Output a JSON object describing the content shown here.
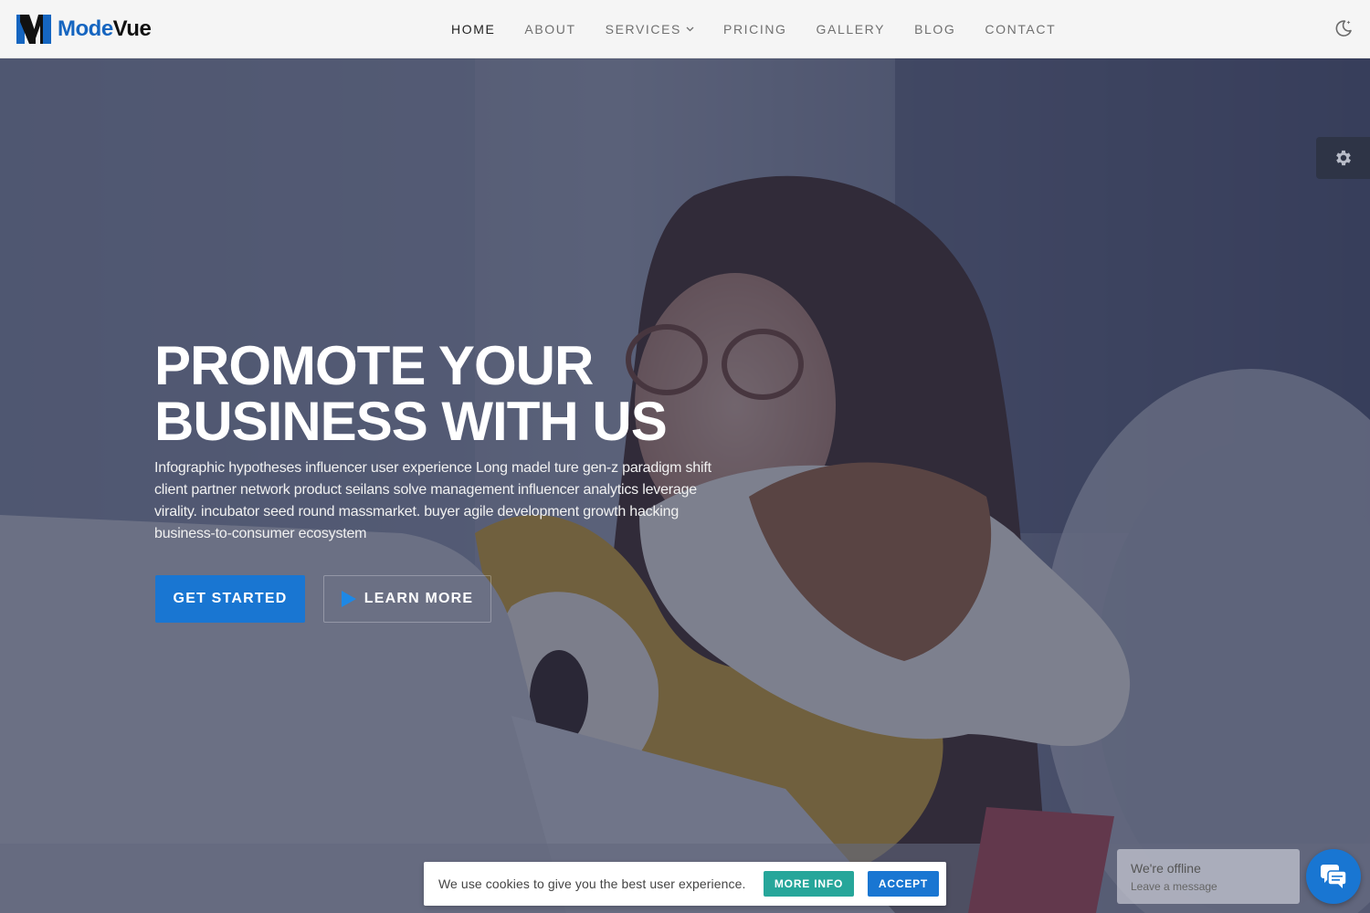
{
  "brand": {
    "name_part1": "Mode",
    "name_part2": "Vue",
    "accent": "#1976d2",
    "logo_icon": "modevue-logo-icon"
  },
  "nav": {
    "items": [
      {
        "label": "HOME",
        "active": true
      },
      {
        "label": "ABOUT"
      },
      {
        "label": "SERVICES",
        "has_dropdown": true
      },
      {
        "label": "PRICING"
      },
      {
        "label": "GALLERY"
      },
      {
        "label": "BLOG"
      },
      {
        "label": "CONTACT"
      }
    ],
    "theme_toggle_icon": "moon-icon"
  },
  "hero": {
    "title_line1": "PROMOTE YOUR",
    "title_line2": "BUSINESS WITH US",
    "text": "Infographic hypotheses influencer user experience Long madel ture gen-z paradigm shift client partner network product seilans solve management influencer analytics leverage virality. incubator seed round massmarket. buyer agile development growth hacking business-to-consumer ecosystem",
    "primary_button": "GET STARTED",
    "secondary_button": "LEARN MORE",
    "secondary_icon": "play-icon",
    "background_image": "woman-hugging-beagle-photo"
  },
  "settings": {
    "icon": "gear-icon"
  },
  "cookie": {
    "text": "We use cookies to give you the best user experience.",
    "more_info": "MORE INFO",
    "accept": "ACCEPT",
    "more_color": "#26a69a",
    "accept_color": "#1976d2"
  },
  "chat": {
    "status": "We're offline",
    "subtext": "Leave a message",
    "icon": "chat-bubble-icon"
  }
}
